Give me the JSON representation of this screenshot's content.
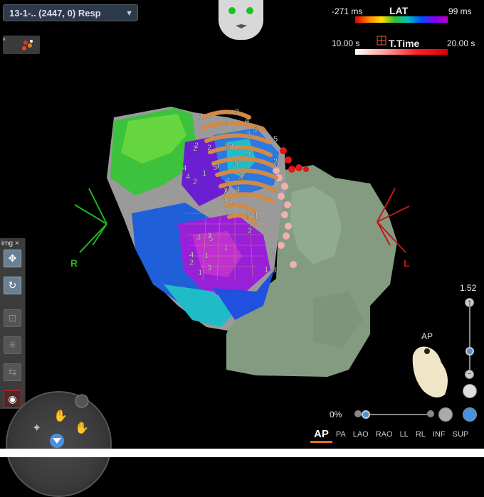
{
  "map_selector": {
    "label": "13-1-.. (2447, 0) Resp"
  },
  "mini_toolbar": {
    "close": "×"
  },
  "lat_scale": {
    "min": "-271 ms",
    "title": "LAT",
    "max": "99 ms"
  },
  "time_scale": {
    "min": "10.00 s",
    "title": "T.Time",
    "max": "20.00 s"
  },
  "orientation": {
    "right": "R",
    "left": "L"
  },
  "tool_panel": {
    "title": "img",
    "close": "×"
  },
  "zoom": {
    "value": "1.52",
    "plus": "+",
    "minus": "−",
    "level": 0.3
  },
  "opacity": {
    "value": "0%",
    "level": 0.1
  },
  "view_orientation_label": "AP",
  "view_tabs": [
    "AP",
    "PA",
    "LAO",
    "RAO",
    "LL",
    "RL",
    "INF",
    "SUP"
  ],
  "tag_numbers": [
    "1",
    "2",
    "5",
    "4",
    "3",
    "5",
    "4",
    "3",
    "2",
    "4",
    "1",
    "3",
    "2",
    "5",
    "4",
    "3",
    "1",
    "2",
    "5",
    "3",
    "4",
    "2",
    "1",
    "5",
    "3",
    "1",
    "2",
    "3",
    "4",
    "5",
    "2",
    "3",
    "1",
    "4",
    "2",
    "5",
    "3",
    "1",
    "2",
    "4",
    "3",
    "5",
    "1",
    "2",
    "3",
    "4"
  ],
  "colors": {
    "accent": "#e07020",
    "face_eyes": "#19c419",
    "right_marker": "#1fb41f",
    "left_marker": "#c01818",
    "ct_green": "#8aa488",
    "catheter": "#d08a4a"
  }
}
